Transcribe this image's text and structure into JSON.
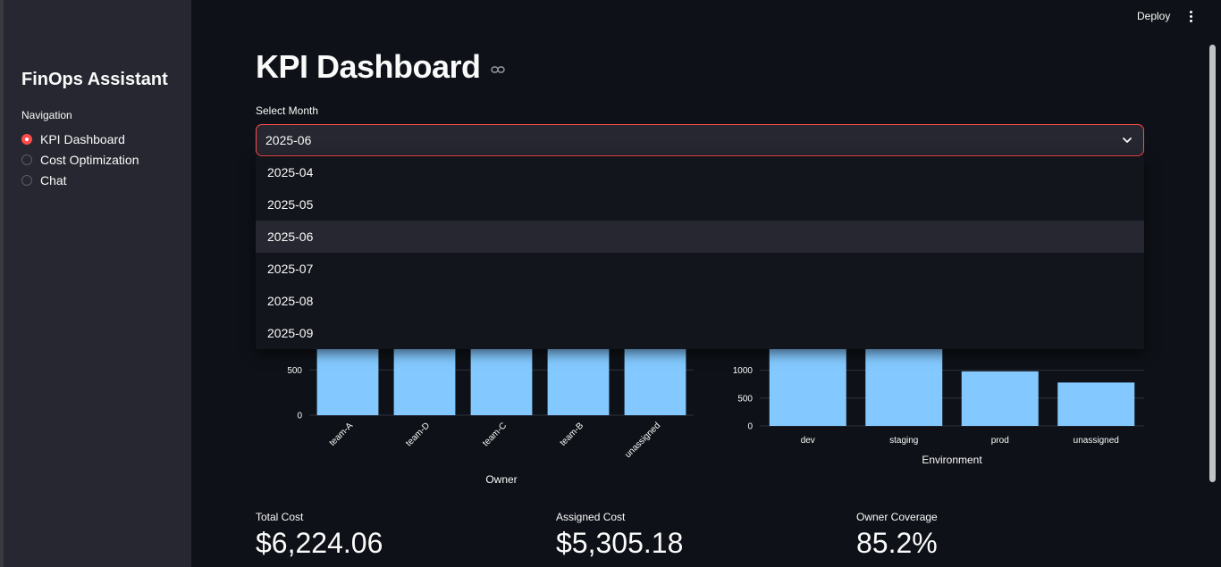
{
  "header": {
    "deploy_label": "Deploy"
  },
  "sidebar": {
    "title": "FinOps Assistant",
    "nav_label": "Navigation",
    "items": [
      {
        "label": "KPI Dashboard",
        "selected": true
      },
      {
        "label": "Cost Optimization",
        "selected": false
      },
      {
        "label": "Chat",
        "selected": false
      }
    ]
  },
  "main": {
    "title": "KPI Dashboard",
    "select": {
      "label": "Select Month",
      "value": "2025-06",
      "options": [
        "2025-04",
        "2025-05",
        "2025-06",
        "2025-07",
        "2025-08",
        "2025-09"
      ],
      "highlighted": "2025-06"
    },
    "metrics": [
      {
        "label": "Total Cost",
        "value": "$6,224.06"
      },
      {
        "label": "Assigned Cost",
        "value": "$5,305.18"
      },
      {
        "label": "Owner Coverage",
        "value": "85.2%"
      }
    ]
  },
  "colors": {
    "accent": "#ff4b4b",
    "bar": "#83c9ff",
    "sidebar": "#262730",
    "background": "#0e1117"
  },
  "chart_data": [
    {
      "type": "bar",
      "categories": [
        "team-A",
        "team-D",
        "team-C",
        "team-B",
        "unassigned"
      ],
      "values": [
        1400,
        1300,
        1200,
        1100,
        920
      ],
      "xlabel": "Owner",
      "yticks": [
        0,
        500
      ],
      "ylim": [
        0,
        1600
      ],
      "visible_ylim": [
        0,
        730
      ]
    },
    {
      "type": "bar",
      "categories": [
        "dev",
        "staging",
        "prod",
        "unassigned"
      ],
      "values": [
        2000,
        1800,
        980,
        780
      ],
      "xlabel": "Environment",
      "yticks": [
        0,
        500,
        1000
      ],
      "ylim": [
        0,
        2200
      ],
      "visible_ylim": [
        0,
        1380
      ]
    }
  ]
}
